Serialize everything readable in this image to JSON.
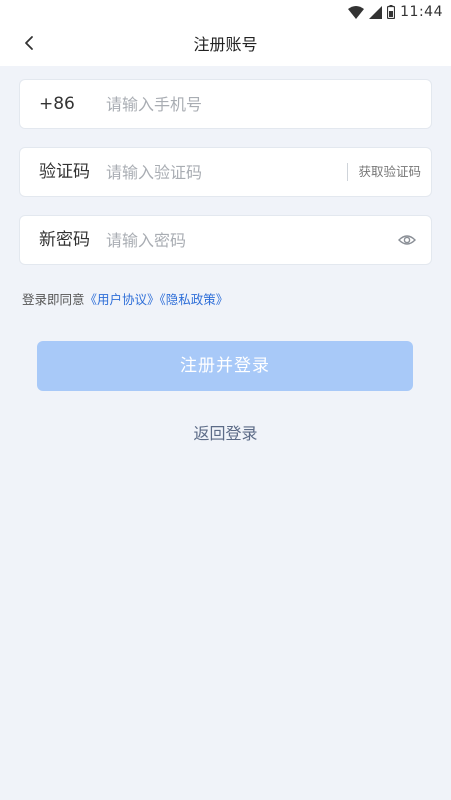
{
  "status_bar": {
    "time": "11:44",
    "icons": [
      "wifi-icon",
      "signal-icon",
      "battery-icon"
    ]
  },
  "header": {
    "title": "注册账号",
    "back_icon": "chevron-left-icon"
  },
  "form": {
    "phone": {
      "label": "+86",
      "placeholder": "请输入手机号",
      "value": ""
    },
    "code": {
      "label": "验证码",
      "placeholder": "请输入验证码",
      "value": "",
      "get_code_label": "获取验证码"
    },
    "password": {
      "label": "新密码",
      "placeholder": "请输入密码",
      "value": "",
      "toggle_icon": "eye-icon"
    }
  },
  "agreement": {
    "prefix": "登录即同意",
    "user_agreement": "《用户协议》",
    "privacy_policy": "《隐私政策》"
  },
  "actions": {
    "register_label": "注册并登录",
    "back_login_label": "返回登录"
  },
  "colors": {
    "background": "#f0f3f9",
    "primary_disabled": "#a8c9f8",
    "link": "#2f6fd8"
  }
}
